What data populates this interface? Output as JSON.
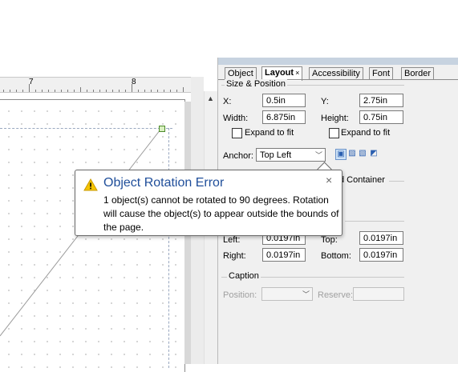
{
  "ruler": {
    "labels": [
      "7",
      "8"
    ]
  },
  "panel": {
    "tabs": [
      {
        "label": "Object"
      },
      {
        "label": "Layout"
      },
      {
        "label": "Accessibility"
      },
      {
        "label": "Font"
      },
      {
        "label": "Border"
      }
    ],
    "active_tab_close": "×",
    "size_position": {
      "title": "Size & Position",
      "x_label": "X:",
      "x_value": "0.5in",
      "y_label": "Y:",
      "y_value": "2.75in",
      "width_label": "Width:",
      "width_value": "6.875in",
      "height_label": "Height:",
      "height_value": "0.75in",
      "expand_fit_1": "Expand to fit",
      "expand_fit_2": "Expand to fit",
      "anchor_label": "Anchor:",
      "anchor_value": "Top Left"
    },
    "container": {
      "title_fragment": "d Container"
    },
    "margins": {
      "left_label": "Left:",
      "left_value": "0.0197in",
      "top_label": "Top:",
      "top_value": "0.0197in",
      "right_label": "Right:",
      "right_value": "0.0197in",
      "bottom_label": "Bottom:",
      "bottom_value": "0.0197in"
    },
    "caption": {
      "title": "Caption",
      "position_label": "Position:",
      "reserve_label": "Reserve:"
    }
  },
  "tooltip": {
    "title": "Object Rotation Error",
    "message": "1 object(s) cannot be rotated to 90 degrees.  Rotation will cause the object(s) to appear outside the bounds of the page.",
    "close": "×"
  }
}
